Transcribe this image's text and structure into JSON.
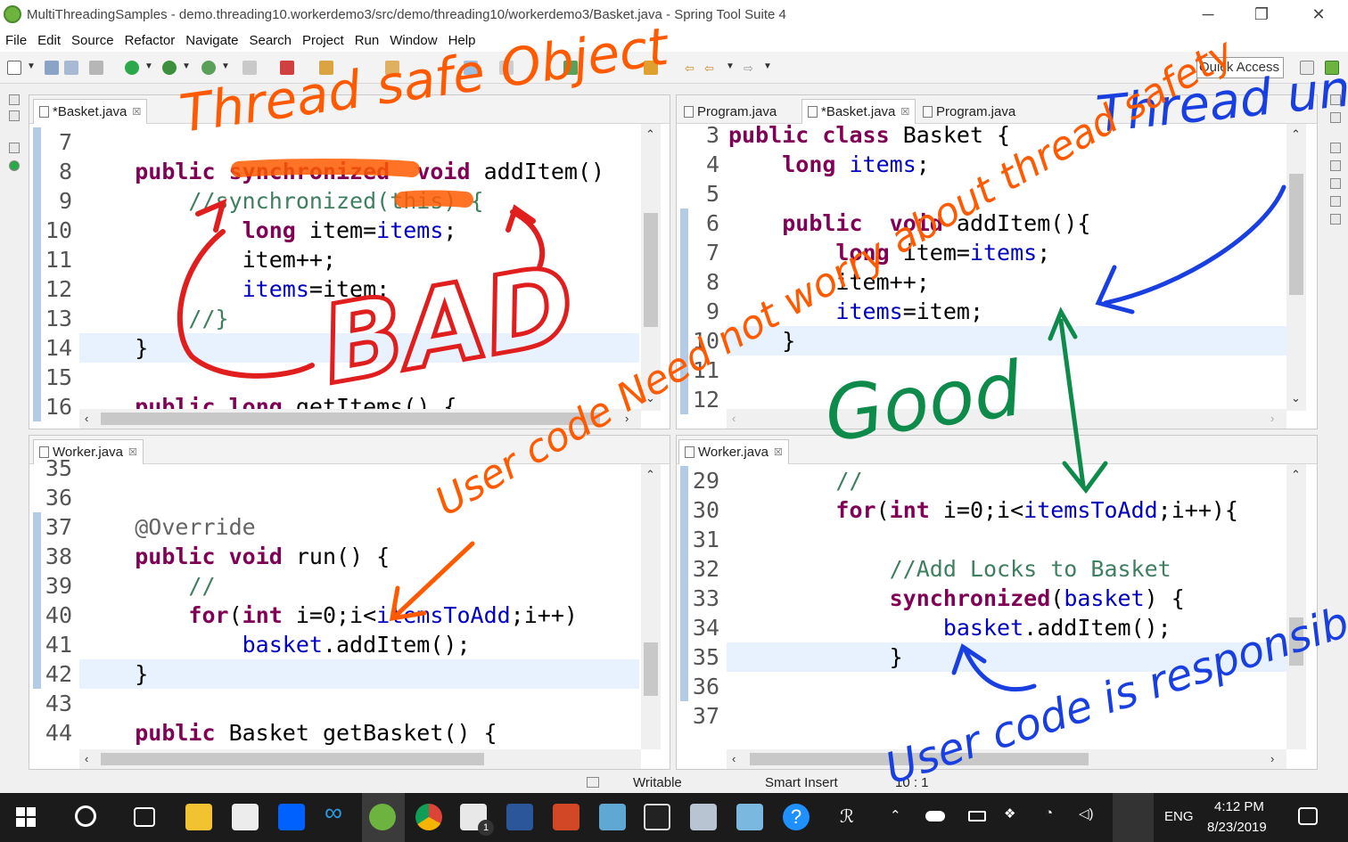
{
  "window": {
    "title": "MultiThreadingSamples - demo.threading10.workerdemo3/src/demo/threading10/workerdemo3/Basket.java - Spring Tool Suite 4",
    "min": "─",
    "max": "❐",
    "close": "✕"
  },
  "menu": [
    "File",
    "Edit",
    "Source",
    "Refactor",
    "Navigate",
    "Search",
    "Project",
    "Run",
    "Window",
    "Help"
  ],
  "toolbar": {
    "quick_access": "Quick Access"
  },
  "panes": {
    "top_left": {
      "tabs": [
        {
          "label": "*Basket.java",
          "close": "☒"
        }
      ],
      "lines": [
        {
          "n": "7",
          "html": ""
        },
        {
          "n": "8",
          "html": "    <span class='kw'>public</span> <span class='kw'>synchronized</span>  <span class='kw'>void</span> addItem()"
        },
        {
          "n": "9",
          "html": "        <span class='cm'>//synchronized(this) {</span>"
        },
        {
          "n": "10",
          "html": "            <span class='kw'>long</span> item=<span class='fld'>items</span>;"
        },
        {
          "n": "11",
          "html": "            item++;"
        },
        {
          "n": "12",
          "html": "            <span class='fld'>items</span>=item;"
        },
        {
          "n": "13",
          "html": "        <span class='cm'>//}</span>"
        },
        {
          "n": "14",
          "html": "    }"
        },
        {
          "n": "15",
          "html": ""
        },
        {
          "n": "16",
          "html": "    <span class='kw'>public</span> <span class='kw'>long</span> getItems() {"
        }
      ]
    },
    "top_right": {
      "tabs": [
        {
          "label": "Program.java"
        },
        {
          "label": "*Basket.java",
          "close": "☒"
        },
        {
          "label": "Program.java"
        }
      ],
      "lines": [
        {
          "n": "3",
          "html": "<span class='kw'>public</span> <span class='kw'>class</span> Basket {"
        },
        {
          "n": "4",
          "html": "    <span class='kw'>long</span> <span class='fld'>items</span>;"
        },
        {
          "n": "5",
          "html": ""
        },
        {
          "n": "6",
          "html": "    <span class='kw'>public</span>  <span class='kw'>void</span> addItem(){"
        },
        {
          "n": "7",
          "html": "        <span class='kw'>long</span> item=<span class='fld'>items</span>;"
        },
        {
          "n": "8",
          "html": "        item++;"
        },
        {
          "n": "9",
          "html": "        <span class='fld'>items</span>=item;"
        },
        {
          "n": "10",
          "html": "    }"
        },
        {
          "n": "11",
          "html": ""
        },
        {
          "n": "12",
          "html": ""
        }
      ]
    },
    "bottom_left": {
      "tabs": [
        {
          "label": "Worker.java",
          "close": "☒"
        }
      ],
      "lines": [
        {
          "n": "35",
          "html": ""
        },
        {
          "n": "36",
          "html": ""
        },
        {
          "n": "37",
          "html": "    <span class='ann'>@Override</span>"
        },
        {
          "n": "38",
          "html": "    <span class='kw'>public</span> <span class='kw'>void</span> run() {"
        },
        {
          "n": "39",
          "html": "        <span class='cm'>//</span>"
        },
        {
          "n": "40",
          "html": "        <span class='kw'>for</span>(<span class='kw'>int</span> i=0;i&lt;<span class='fld'>itemsToAdd</span>;i++)"
        },
        {
          "n": "41",
          "html": "            <span class='fld'>basket</span>.addItem();"
        },
        {
          "n": "42",
          "html": "    }"
        },
        {
          "n": "43",
          "html": ""
        },
        {
          "n": "44",
          "html": "    <span class='kw'>public</span> Basket getBasket() {"
        }
      ]
    },
    "bottom_right": {
      "tabs": [
        {
          "label": "Worker.java",
          "close": "☒"
        }
      ],
      "lines": [
        {
          "n": "29",
          "html": "        <span class='cm'>//</span>"
        },
        {
          "n": "30",
          "html": "        <span class='kw'>for</span>(<span class='kw'>int</span> i=0;i&lt;<span class='fld'>itemsToAdd</span>;i++){"
        },
        {
          "n": "31",
          "html": ""
        },
        {
          "n": "32",
          "html": "            <span class='cm'>//Add Locks to Basket</span>"
        },
        {
          "n": "33",
          "html": "            <span class='kw'>synchronized</span>(<span class='fld'>basket</span>) {"
        },
        {
          "n": "34",
          "html": "                <span class='fld'>basket</span>.addItem();"
        },
        {
          "n": "35",
          "html": "            }"
        },
        {
          "n": "36",
          "html": ""
        },
        {
          "n": "37",
          "html": ""
        }
      ]
    }
  },
  "status": {
    "writable": "Writable",
    "insert": "Smart Insert",
    "position": "10 : 1"
  },
  "taskbar": {
    "time": "4:12 PM",
    "date": "8/23/2019",
    "lang": "ENG",
    "mail_badge": "1"
  },
  "annotations": {
    "thread_safe_object": "Thread safe Object",
    "bad": "BAD",
    "thread_unsafe": "Thread un safe",
    "good": "Good",
    "user_code": "User code Need not worry about thread safety",
    "user_code_resp": "User code is responsible for Thread safety"
  },
  "colors": {
    "ink_orange": "#ff5a00",
    "ink_red": "#e01e1e",
    "ink_blue": "#1a3fe0",
    "ink_green": "#0e8a4a",
    "accent": "#6db33f"
  }
}
